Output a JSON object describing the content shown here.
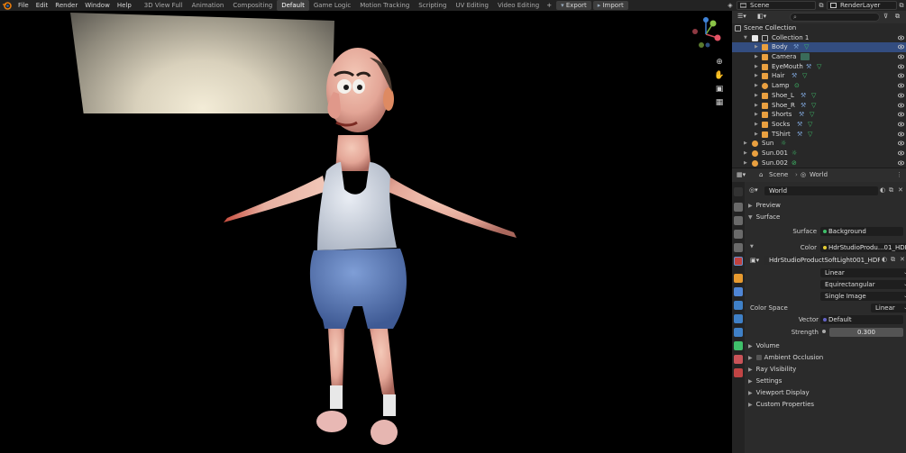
{
  "menu": {
    "file": "File",
    "edit": "Edit",
    "render": "Render",
    "window": "Window",
    "help": "Help"
  },
  "workspace_tabs": [
    "3D View Full",
    "Animation",
    "Compositing",
    "Default",
    "Game Logic",
    "Motion Tracking",
    "Scripting",
    "UV Editing",
    "Video Editing"
  ],
  "active_tab": "Default",
  "tab_add": "+",
  "buttons": {
    "export": "Export",
    "import": "Import"
  },
  "scene": {
    "name": "Scene",
    "render_layer": "RenderLayer"
  },
  "outliner": {
    "scene_collection": "Scene Collection",
    "collection_1": "Collection 1",
    "objects": [
      {
        "name": "Body",
        "selected": true
      },
      {
        "name": "Camera"
      },
      {
        "name": "EyeMouth"
      },
      {
        "name": "Hair"
      },
      {
        "name": "Lamp"
      },
      {
        "name": "Shoe_L"
      },
      {
        "name": "Shoe_R"
      },
      {
        "name": "Shorts"
      },
      {
        "name": "Socks"
      },
      {
        "name": "TShirt"
      }
    ],
    "root_objects": [
      "Sun",
      "Sun.001",
      "Sun.002"
    ]
  },
  "properties": {
    "breadcrumb_scene": "Scene",
    "breadcrumb_world": "World",
    "world_name": "World",
    "panels": {
      "preview": "Preview",
      "surface": "Surface"
    },
    "surface_label": "Surface",
    "surface_value": "Background",
    "color_label": "Color",
    "color_value": "HdrStudioProdu...01_HDR_4K.exr",
    "image_name": "HdrStudioProductSoftLight001_HDR_4K...",
    "interpolation": "Linear",
    "projection": "Equirectangular",
    "source": "Single Image",
    "color_space_label": "Color Space",
    "color_space_value": "Linear",
    "vector_label": "Vector",
    "vector_value": "Default",
    "strength_label": "Strength",
    "strength_value": "0.300",
    "sections": {
      "volume": "Volume",
      "ambient_occlusion": "Ambient Occlusion",
      "ray_visibility": "Ray Visibility",
      "settings": "Settings",
      "viewport_display": "Viewport Display",
      "custom_properties": "Custom Properties"
    }
  },
  "colors": {
    "selection": "#334d80",
    "shader_yellow": "#e5cc33",
    "vector_purple": "#6363c7",
    "mesh_green": "#3fbf6a"
  }
}
